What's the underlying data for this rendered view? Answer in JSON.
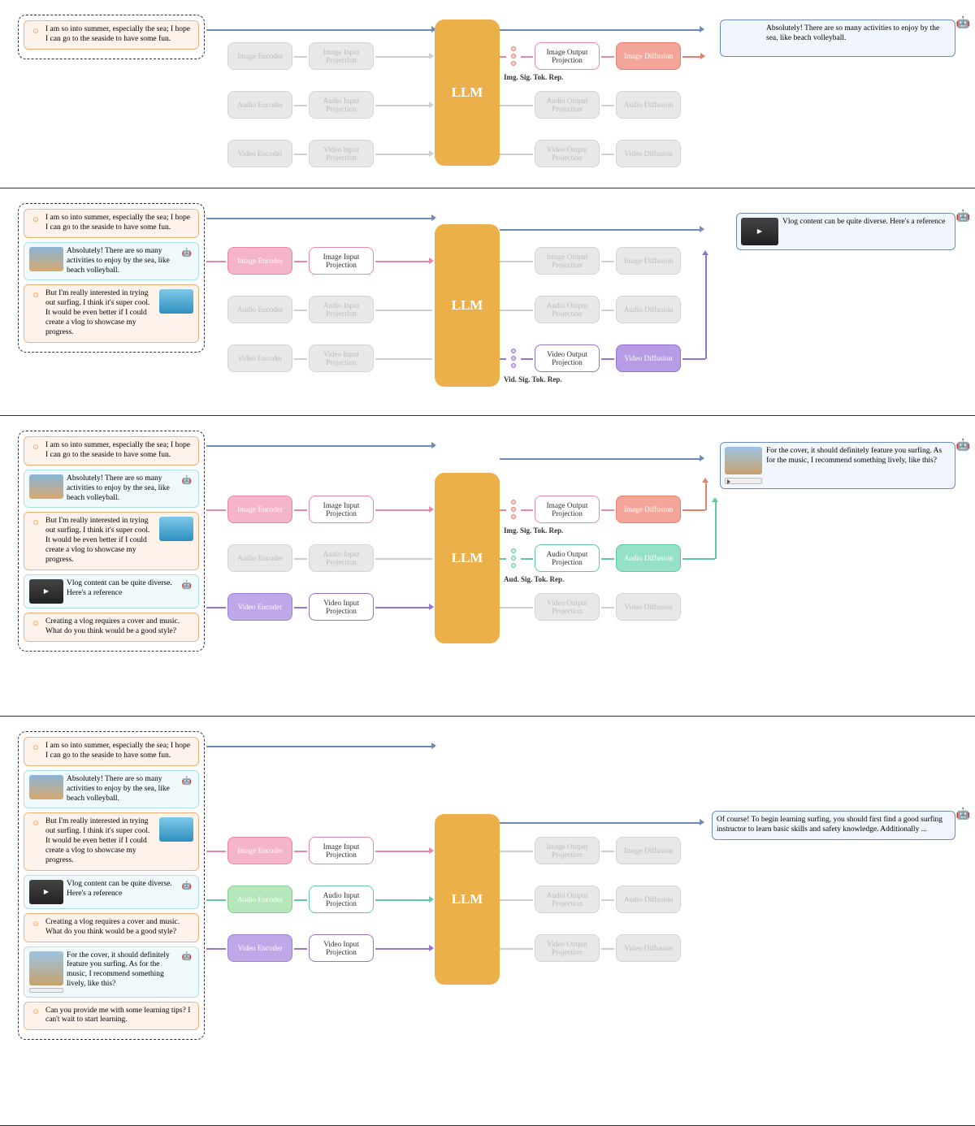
{
  "common": {
    "llm": "LLM",
    "imgEnc": "Image Encoder",
    "audEnc": "Audio Encoder",
    "vidEnc": "Video Encoder",
    "imgInProj": "Image Input Projection",
    "audInProj": "Audio Input Projection",
    "vidInProj": "Video Input Projection",
    "imgOutProj": "Image Output Projection",
    "audOutProj": "Audio Output Projection",
    "vidOutProj": "Video Output Projection",
    "imgDiff": "Image Diffusion",
    "audDiff": "Audio Diffusion",
    "vidDiff": "Video Diffusion",
    "imgTok": "Img. Sig. Tok. Rep.",
    "audTok": "Aud. Sig. Tok. Rep.",
    "vidTok": "Vid. Sig. Tok. Rep."
  },
  "msgs": {
    "u1": "I am so into summer, especially the sea; I hope I can go to the seaside to have some fun.",
    "b1": "Absolutely! There are so many activities to enjoy by the sea, like beach volleyball.",
    "u2": "But I'm really interested in trying out surfing. I think it's super cool. It would be even better if I could create a vlog to showcase my progress.",
    "b2": "Vlog content can be quite diverse. Here's a reference",
    "u3": "Creating a vlog requires a cover and music. What do you think would be a good style?",
    "b3": "For the cover, it should definitely feature you surfing. As for the music, I recommend something lively, like this?",
    "u4": "Can you provide me with some learning tips? I can't wait to start learning.",
    "b4": "Of course! To begin learning surfing, you should first find a good surfing instructor to learn basic skills and safety knowledge. Additionally ..."
  },
  "panels": {
    "p1": {
      "inGhost": {
        "img": true,
        "aud": true,
        "vid": true
      },
      "outActive": {
        "img": true,
        "aud": false,
        "vid": false
      },
      "out": "b1",
      "outHasImg": true
    },
    "p2": {
      "inGhost": {
        "img": false,
        "aud": true,
        "vid": true
      },
      "outActive": {
        "img": false,
        "aud": false,
        "vid": true
      },
      "out": "b2",
      "outHasVid": true
    },
    "p3": {
      "inGhost": {
        "img": false,
        "aud": true,
        "vid": false
      },
      "outActive": {
        "img": true,
        "aud": true,
        "vid": false
      },
      "out": "b3",
      "outHasImg": true,
      "outHasAud": true
    },
    "p4": {
      "inGhost": {
        "img": false,
        "aud": false,
        "vid": false
      },
      "outActive": {
        "img": false,
        "aud": false,
        "vid": false
      },
      "out": "b4"
    }
  }
}
